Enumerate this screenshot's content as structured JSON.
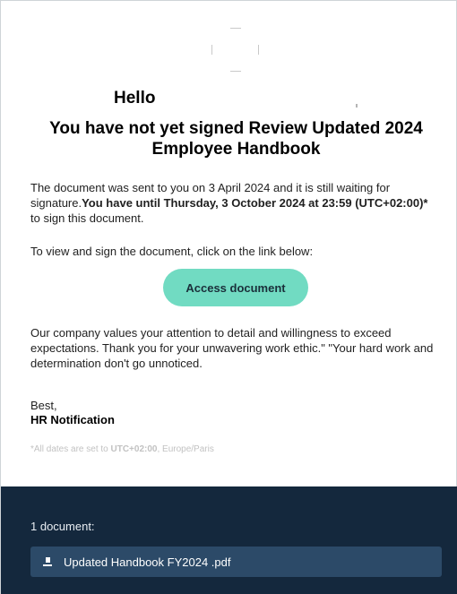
{
  "email": {
    "greeting": "Hello",
    "headline": "You have not yet signed Review Updated 2024 Employee Handbook",
    "body": {
      "sent_intro": "The document was sent to you on 3 April 2024 and it is still waiting for signature.",
      "deadline": "You have until Thursday, 3 October 2024 at 23:59 (UTC+02:00)*",
      "deadline_suffix": " to sign this document.",
      "instruction": "To view and sign the document, click on the link below:",
      "closing_message": "Our company values your attention to detail and willingness to exceed expectations. Thank you for your unwavering work ethic.\" \"Your hard work and determination don't go unnoticed."
    },
    "cta_label": "Access document",
    "signoff": "Best,",
    "signature": "HR Notification",
    "timezone_note": {
      "prefix": "*All dates are set to ",
      "zone": "UTC+02:00",
      "suffix": ", Europe/Paris"
    }
  },
  "footer": {
    "document_count": "1 document:",
    "documents": [
      {
        "name": "Updated Handbook FY2024 .pdf",
        "icon": "file-icon"
      }
    ]
  },
  "colors": {
    "cta_background": "#71dbc2",
    "footer_background": "#14283d",
    "document_row_background": "#2c4a68"
  }
}
